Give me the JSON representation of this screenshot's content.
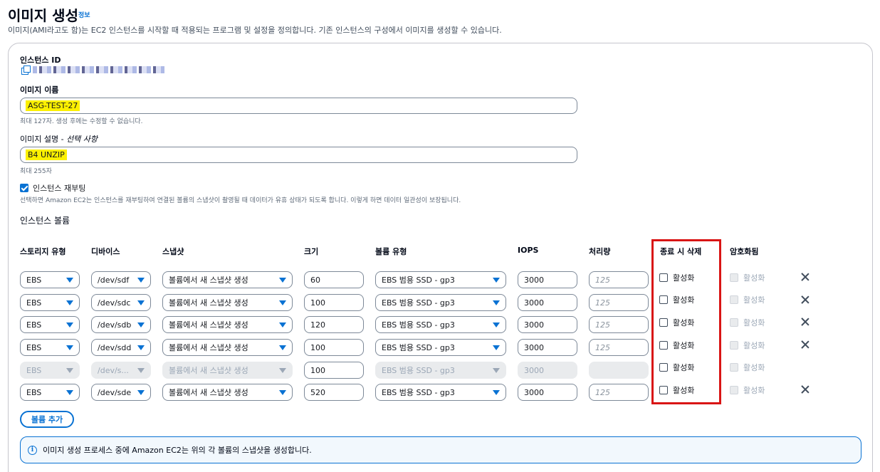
{
  "header": {
    "title": "이미지 생성",
    "info_link": "정보",
    "description": "이미지(AMI라고도 함)는 EC2 인스턴스를 시작할 때 적용되는 프로그램 및 설정을 정의합니다. 기존 인스턴스의 구성에서 이미지를 생성할 수 있습니다."
  },
  "form": {
    "instance_id_label": "인스턴스 ID",
    "image_name_label": "이미지 이름",
    "image_name_value": "ASG-TEST-27",
    "image_name_hint": "최대 127자. 생성 후에는 수정할 수 없습니다.",
    "image_desc_label": "이미지 설명 - ",
    "image_desc_optional": "선택 사항",
    "image_desc_value": "B4 UNZIP",
    "image_desc_hint": "최대 255자",
    "reboot_label": "인스턴스 재부팅",
    "reboot_checked": true,
    "reboot_hint": "선택하면 Amazon EC2는 인스턴스를 재부팅하여 연결된 볼륨의 스냅샷이 촬영될 때 데이터가 유휴 상태가 되도록 합니다. 이렇게 하면 데이터 일관성이 보장됩니다."
  },
  "volumes": {
    "section_title": "인스턴스 볼륨",
    "columns": {
      "storage_type": "스토리지 유형",
      "device": "디바이스",
      "snapshot": "스냅샷",
      "size": "크기",
      "volume_type": "볼륨 유형",
      "iops": "IOPS",
      "throughput": "처리량",
      "delete_on_termination": "종료 시 삭제",
      "encrypted": "암호화됨"
    },
    "rows": [
      {
        "storage": "EBS",
        "device": "/dev/sdf",
        "snapshot": "볼륨에서 새 스냅샷 생성",
        "size": "60",
        "vtype": "EBS 범용 SSD - gp3",
        "iops": "3000",
        "throughput": "125",
        "delete_label": "활성화",
        "encrypt_label": "활성화"
      },
      {
        "storage": "EBS",
        "device": "/dev/sdc",
        "snapshot": "볼륨에서 새 스냅샷 생성",
        "size": "100",
        "vtype": "EBS 범용 SSD - gp3",
        "iops": "3000",
        "throughput": "125",
        "delete_label": "활성화",
        "encrypt_label": "활성화"
      },
      {
        "storage": "EBS",
        "device": "/dev/sdb",
        "snapshot": "볼륨에서 새 스냅샷 생성",
        "size": "120",
        "vtype": "EBS 범용 SSD - gp3",
        "iops": "3000",
        "throughput": "125",
        "delete_label": "활성화",
        "encrypt_label": "활성화"
      },
      {
        "storage": "EBS",
        "device": "/dev/sdd",
        "snapshot": "볼륨에서 새 스냅샷 생성",
        "size": "100",
        "vtype": "EBS 범용 SSD - gp3",
        "iops": "3000",
        "throughput": "125",
        "delete_label": "활성화",
        "encrypt_label": "활성화"
      },
      {
        "storage": "EBS",
        "device": "/dev/s...",
        "snapshot": "볼륨에서 새 스냅샷 생성",
        "size": "100",
        "vtype": "EBS 범용 SSD - gp3",
        "iops": "3000",
        "throughput": "",
        "delete_label": "활성화",
        "encrypt_label": "활성화"
      },
      {
        "storage": "EBS",
        "device": "/dev/sde",
        "snapshot": "볼륨에서 새 스냅샷 생성",
        "size": "520",
        "vtype": "EBS 범용 SSD - gp3",
        "iops": "3000",
        "throughput": "125",
        "delete_label": "활성화",
        "encrypt_label": "활성화"
      }
    ],
    "add_button": "볼륨 추가"
  },
  "alert": {
    "text": "이미지 생성 프로세스 중에 Amazon EC2는 위의 각 볼륨의 스냅샷을 생성합니다."
  },
  "colors": {
    "accent": "#0972d3",
    "highlight": "#fcf000",
    "annotation_box": "#d91515"
  }
}
